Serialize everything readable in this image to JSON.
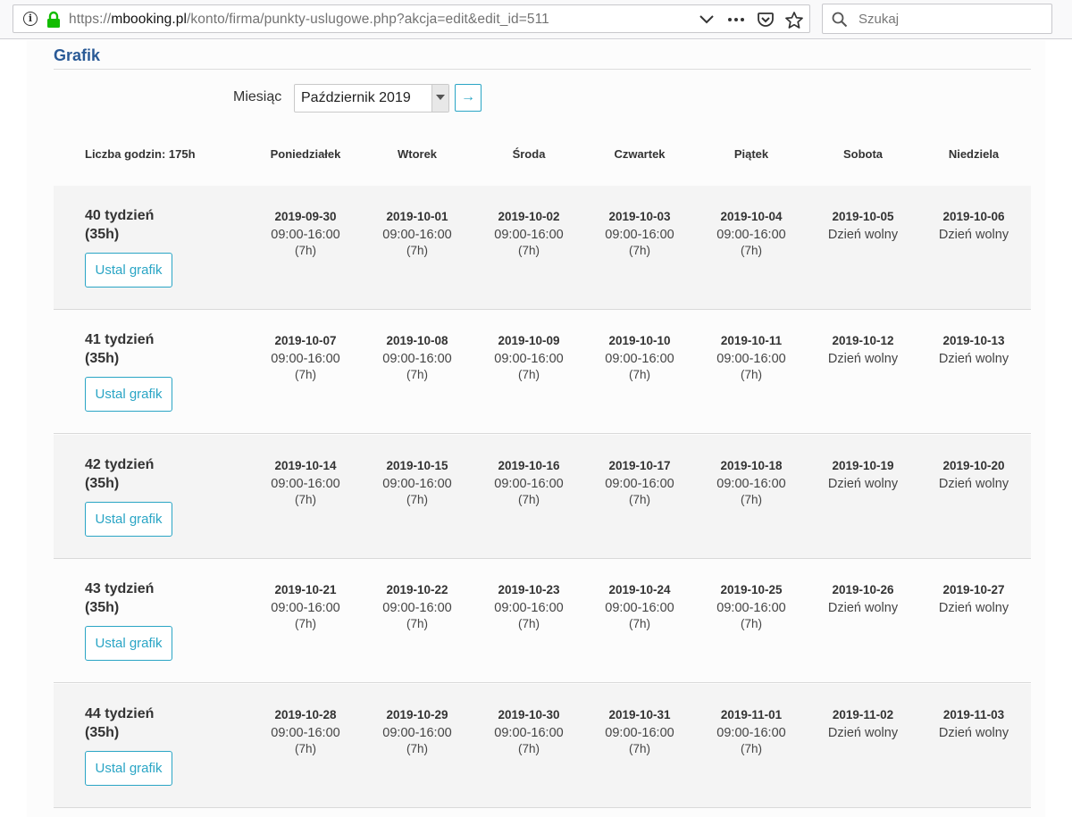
{
  "browser": {
    "url_prefix": "https://",
    "url_host": "mbooking.pl",
    "url_path": "/konto/firma/punkty-uslugowe.php?akcja=edit&edit_id=511",
    "search_placeholder": "Szukaj"
  },
  "section": {
    "title": "Grafik",
    "month_label": "Miesiąc",
    "month_value": "Październik 2019",
    "go_label": "→"
  },
  "schedule": {
    "hours_total": "Liczba godzin: 175h",
    "days": [
      "Poniedziałek",
      "Wtorek",
      "Środa",
      "Czwartek",
      "Piątek",
      "Sobota",
      "Niedziela"
    ],
    "button_label": "Ustal grafik",
    "weeks": [
      {
        "title": "40 tydzień",
        "hours": "(35h)",
        "cells": [
          {
            "date": "2019-09-30",
            "hours": "09:00-16:00",
            "dur": "(7h)"
          },
          {
            "date": "2019-10-01",
            "hours": "09:00-16:00",
            "dur": "(7h)"
          },
          {
            "date": "2019-10-02",
            "hours": "09:00-16:00",
            "dur": "(7h)"
          },
          {
            "date": "2019-10-03",
            "hours": "09:00-16:00",
            "dur": "(7h)"
          },
          {
            "date": "2019-10-04",
            "hours": "09:00-16:00",
            "dur": "(7h)"
          },
          {
            "date": "2019-10-05",
            "hours": "Dzień wolny",
            "dur": ""
          },
          {
            "date": "2019-10-06",
            "hours": "Dzień wolny",
            "dur": ""
          }
        ]
      },
      {
        "title": "41 tydzień",
        "hours": "(35h)",
        "cells": [
          {
            "date": "2019-10-07",
            "hours": "09:00-16:00",
            "dur": "(7h)"
          },
          {
            "date": "2019-10-08",
            "hours": "09:00-16:00",
            "dur": "(7h)"
          },
          {
            "date": "2019-10-09",
            "hours": "09:00-16:00",
            "dur": "(7h)"
          },
          {
            "date": "2019-10-10",
            "hours": "09:00-16:00",
            "dur": "(7h)"
          },
          {
            "date": "2019-10-11",
            "hours": "09:00-16:00",
            "dur": "(7h)"
          },
          {
            "date": "2019-10-12",
            "hours": "Dzień wolny",
            "dur": ""
          },
          {
            "date": "2019-10-13",
            "hours": "Dzień wolny",
            "dur": ""
          }
        ]
      },
      {
        "title": "42 tydzień",
        "hours": "(35h)",
        "cells": [
          {
            "date": "2019-10-14",
            "hours": "09:00-16:00",
            "dur": "(7h)"
          },
          {
            "date": "2019-10-15",
            "hours": "09:00-16:00",
            "dur": "(7h)"
          },
          {
            "date": "2019-10-16",
            "hours": "09:00-16:00",
            "dur": "(7h)"
          },
          {
            "date": "2019-10-17",
            "hours": "09:00-16:00",
            "dur": "(7h)"
          },
          {
            "date": "2019-10-18",
            "hours": "09:00-16:00",
            "dur": "(7h)"
          },
          {
            "date": "2019-10-19",
            "hours": "Dzień wolny",
            "dur": ""
          },
          {
            "date": "2019-10-20",
            "hours": "Dzień wolny",
            "dur": ""
          }
        ]
      },
      {
        "title": "43 tydzień",
        "hours": "(35h)",
        "cells": [
          {
            "date": "2019-10-21",
            "hours": "09:00-16:00",
            "dur": "(7h)"
          },
          {
            "date": "2019-10-22",
            "hours": "09:00-16:00",
            "dur": "(7h)"
          },
          {
            "date": "2019-10-23",
            "hours": "09:00-16:00",
            "dur": "(7h)"
          },
          {
            "date": "2019-10-24",
            "hours": "09:00-16:00",
            "dur": "(7h)"
          },
          {
            "date": "2019-10-25",
            "hours": "09:00-16:00",
            "dur": "(7h)"
          },
          {
            "date": "2019-10-26",
            "hours": "Dzień wolny",
            "dur": ""
          },
          {
            "date": "2019-10-27",
            "hours": "Dzień wolny",
            "dur": ""
          }
        ]
      },
      {
        "title": "44 tydzień",
        "hours": "(35h)",
        "cells": [
          {
            "date": "2019-10-28",
            "hours": "09:00-16:00",
            "dur": "(7h)"
          },
          {
            "date": "2019-10-29",
            "hours": "09:00-16:00",
            "dur": "(7h)"
          },
          {
            "date": "2019-10-30",
            "hours": "09:00-16:00",
            "dur": "(7h)"
          },
          {
            "date": "2019-10-31",
            "hours": "09:00-16:00",
            "dur": "(7h)"
          },
          {
            "date": "2019-11-01",
            "hours": "09:00-16:00",
            "dur": "(7h)"
          },
          {
            "date": "2019-11-02",
            "hours": "Dzień wolny",
            "dur": ""
          },
          {
            "date": "2019-11-03",
            "hours": "Dzień wolny",
            "dur": ""
          }
        ]
      }
    ]
  }
}
